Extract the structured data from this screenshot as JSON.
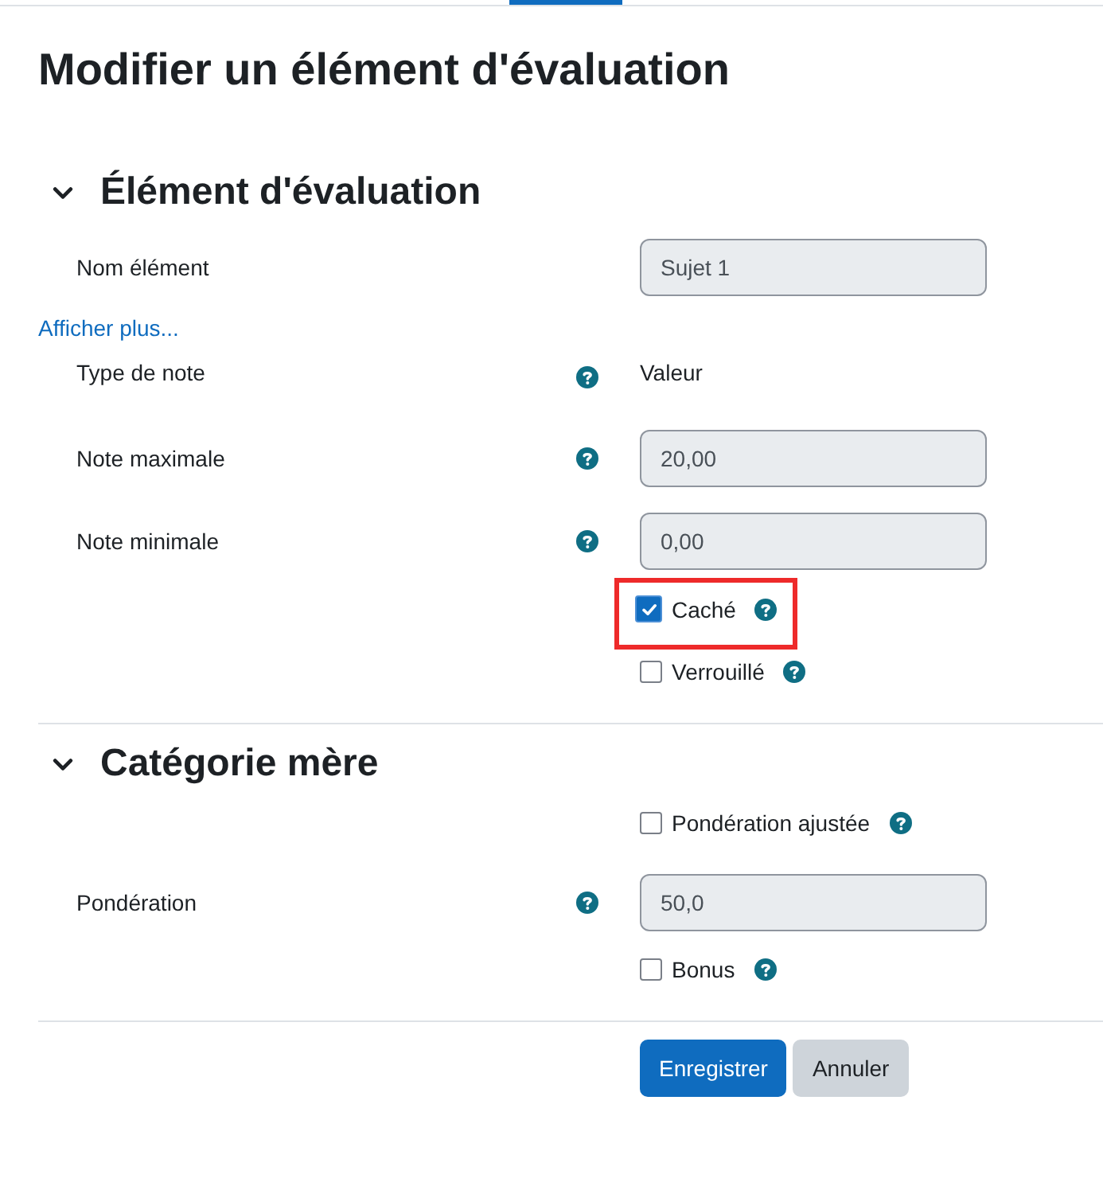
{
  "title": "Modifier un élément d'évaluation",
  "sections": [
    {
      "heading": "Élément d'évaluation",
      "expanded": true,
      "rows": [
        {
          "kind": "field",
          "label": "Nom élément",
          "help": false,
          "value": "Sujet 1"
        },
        {
          "kind": "link",
          "text": "Afficher plus..."
        },
        {
          "kind": "static",
          "label": "Type de note",
          "help": true,
          "value": "Valeur"
        },
        {
          "kind": "field",
          "label": "Note maximale",
          "help": true,
          "value": "20,00"
        },
        {
          "kind": "field",
          "label": "Note minimale",
          "help": true,
          "value": "0,00"
        },
        {
          "kind": "checkbox",
          "text": "Caché",
          "help": true,
          "checked": true,
          "highlighted": true
        },
        {
          "kind": "checkbox",
          "text": "Verrouillé",
          "help": true,
          "checked": false,
          "highlighted": false
        }
      ]
    },
    {
      "heading": "Catégorie mère",
      "expanded": true,
      "rows": [
        {
          "kind": "checkbox",
          "text": "Pondération ajustée",
          "help": true,
          "checked": false,
          "highlighted": false
        },
        {
          "kind": "field",
          "label": "Pondération",
          "help": true,
          "value": "50,0"
        },
        {
          "kind": "checkbox",
          "text": "Bonus",
          "help": true,
          "checked": false,
          "highlighted": false
        }
      ]
    }
  ],
  "buttons": [
    {
      "label": "Enregistrer",
      "kind": "primary"
    },
    {
      "label": "Annuler",
      "kind": "secondary"
    }
  ]
}
